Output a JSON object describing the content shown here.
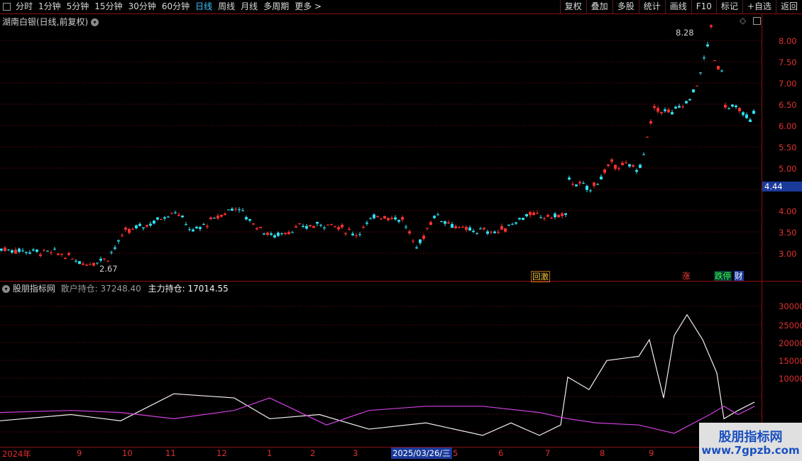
{
  "toolbar": {
    "periods": [
      "分时",
      "1分钟",
      "5分钟",
      "15分钟",
      "30分钟",
      "60分钟",
      "日线",
      "周线",
      "月线",
      "多周期",
      "更多 >"
    ],
    "active_period": "日线",
    "buttons": [
      "复权",
      "叠加",
      "多股",
      "统计",
      "画线",
      "F10",
      "标记",
      "+自选",
      "返回"
    ]
  },
  "main_chart": {
    "title": "湖南白银(日线,前复权)",
    "price_axis": [
      "8.00",
      "7.50",
      "7.00",
      "6.50",
      "6.00",
      "5.50",
      "5.00",
      "4.44",
      "4.00",
      "3.50",
      "3.00"
    ],
    "current_price": "4.44",
    "high_label": "8.28",
    "low_label": "2.67",
    "events": [
      "回激",
      "涨",
      "跌停",
      "财"
    ],
    "colors": {
      "up": "#ff3030",
      "down": "#30e0f0",
      "grid": "#8a1010"
    }
  },
  "indicator": {
    "name": "股朋指标网",
    "retail_label": "散户持仓:",
    "retail_value": "37248.40",
    "main_label": "主力持仓:",
    "main_value": "17014.55",
    "axis": [
      "30000",
      "25000",
      "20000",
      "15000",
      "10000"
    ]
  },
  "date_axis": [
    "2024年",
    "9",
    "10",
    "11",
    "12",
    "1",
    "2",
    "3",
    "2025/03/26/三",
    "5",
    "6",
    "7",
    "8",
    "9"
  ],
  "watermark": {
    "line1": "股朋指标网",
    "line2": "www.7gpzb.com"
  }
}
